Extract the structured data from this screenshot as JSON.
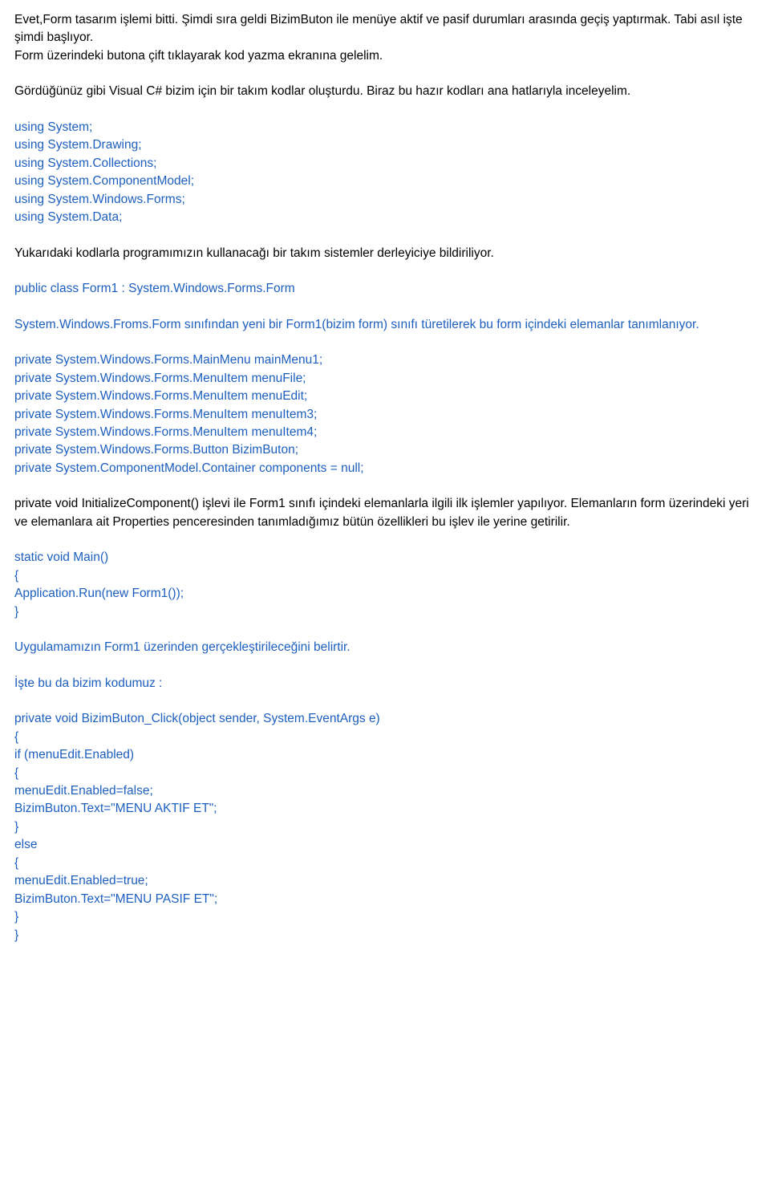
{
  "p1": "Evet,Form tasarım işlemi bitti. Şimdi sıra geldi BizimButon ile menüye aktif ve pasif durumları arasında geçiş yaptırmak. Tabi asıl işte şimdi başlıyor.",
  "p1b": "Form üzerindeki butona çift tıklayarak kod yazma ekranına gelelim.",
  "p2": "Gördüğünüz gibi Visual C# bizim için bir takım kodlar oluşturdu. Biraz bu hazır kodları ana hatlarıyla inceleyelim.",
  "using": [
    "using System;",
    "using System.Drawing;",
    "using System.Collections;",
    "using System.ComponentModel;",
    "using System.Windows.Forms;",
    "using System.Data;"
  ],
  "p3": "Yukarıdaki kodlarla programımızın kullanacağı bir takım sistemler derleyiciye bildiriliyor.",
  "classDecl": "public class Form1 : System.Windows.Forms.Form",
  "p4": "System.Windows.Froms.Form sınıfından yeni bir Form1(bizim form) sınıfı türetilerek bu form içindeki elemanlar tanımlanıyor.",
  "privates": [
    "private System.Windows.Forms.MainMenu mainMenu1;",
    "private System.Windows.Forms.MenuItem menuFile;",
    "private System.Windows.Forms.MenuItem menuEdit;",
    "private System.Windows.Forms.MenuItem menuItem3;",
    "private System.Windows.Forms.MenuItem menuItem4;",
    "private System.Windows.Forms.Button BizimButon;",
    "private System.ComponentModel.Container components = null;"
  ],
  "p5": "private void InitializeComponent() işlevi ile Form1 sınıfı içindeki elemanlarla ilgili ilk işlemler yapılıyor. Elemanların form üzerindeki yeri ve elemanlara ait Properties penceresinden tanımladığımız bütün özellikleri bu işlev ile yerine getirilir.",
  "main": [
    "static void Main()",
    "{",
    "Application.Run(new Form1());",
    "}"
  ],
  "p6": "Uygulamamızın Form1 üzerinden gerçekleştirileceğini belirtir.",
  "p7": "İşte bu da bizim kodumuz :",
  "handler": [
    "private void BizimButon_Click(object sender, System.EventArgs e)",
    "{",
    "if (menuEdit.Enabled)",
    "{",
    "menuEdit.Enabled=false;",
    "BizimButon.Text=\"MENU AKTIF ET\";",
    "}",
    "else",
    "{",
    "menuEdit.Enabled=true;",
    "BizimButon.Text=\"MENU PASIF ET\";",
    "}",
    "}"
  ]
}
